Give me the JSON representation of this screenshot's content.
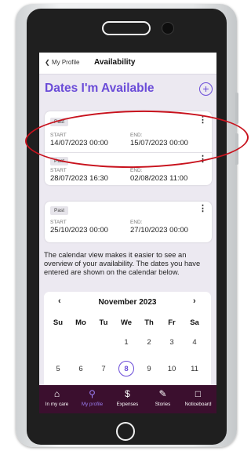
{
  "header": {
    "back_label": "My Profile",
    "title": "Availability"
  },
  "main": {
    "heading": "Dates I'm Available",
    "start_label": "START",
    "end_label": "END:",
    "availability": [
      {
        "status": "Past",
        "start": "14/07/2023 00:00",
        "end": "15/07/2023 00:00"
      },
      {
        "status": "Past",
        "start": "28/07/2023 16:30",
        "end": "02/08/2023 11:00"
      },
      {
        "status": "Past",
        "start": "25/10/2023 00:00",
        "end": "27/10/2023 00:00"
      }
    ],
    "description": "The calendar view makes it easier to see an overview of your availability. The dates you have entered are shown on the calendar below."
  },
  "calendar": {
    "month": "November 2023",
    "weekdays": [
      "Su",
      "Mo",
      "Tu",
      "We",
      "Th",
      "Fr",
      "Sa"
    ],
    "week1": [
      "",
      "",
      "",
      "1",
      "2",
      "3",
      "4"
    ],
    "week2": [
      "5",
      "6",
      "7",
      "8",
      "9",
      "10",
      "11"
    ],
    "selected_day": "8"
  },
  "tabs": [
    {
      "label": "In my care",
      "icon": "home-icon",
      "active": false
    },
    {
      "label": "My profile",
      "icon": "person-icon",
      "active": true
    },
    {
      "label": "Expenses",
      "icon": "dollar-icon",
      "active": false
    },
    {
      "label": "Stories",
      "icon": "edit-icon",
      "active": false
    },
    {
      "label": "Noticeboard",
      "icon": "clipboard-icon",
      "active": false
    }
  ],
  "colors": {
    "accent": "#6a4bd8",
    "tabbar": "#3b0f2e",
    "annotation": "#c8121d",
    "screen_bg": "#ece9f1"
  }
}
